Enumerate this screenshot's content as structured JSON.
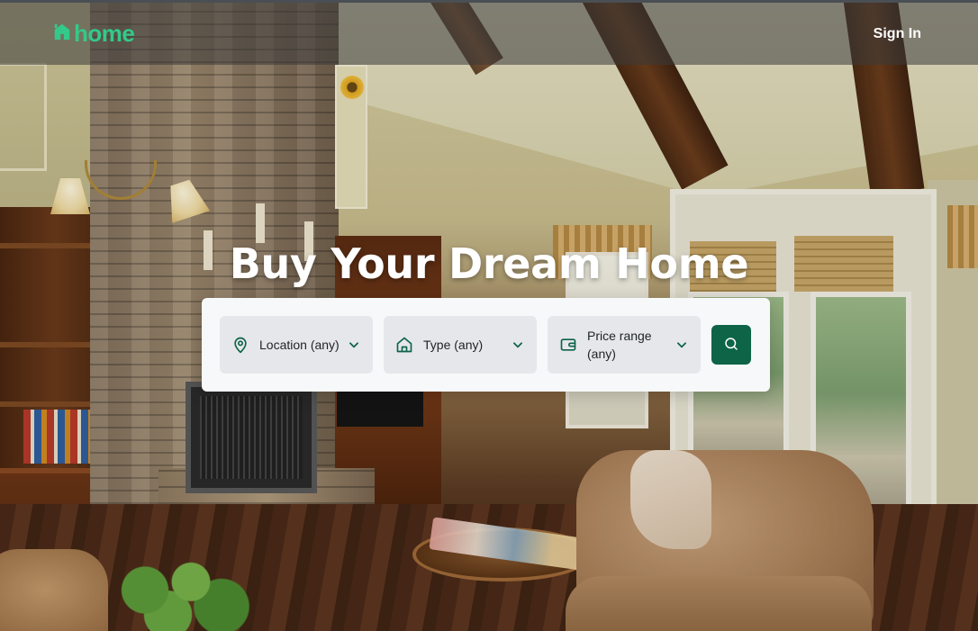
{
  "header": {
    "logo_text": "home",
    "logo_icon": "house-icon",
    "signin_label": "Sign In"
  },
  "hero": {
    "headline": "Buy Your Dream Home"
  },
  "search": {
    "filters": [
      {
        "icon": "map-pin-icon",
        "label": "Location (any)"
      },
      {
        "icon": "house-icon",
        "label": "Type (any)"
      },
      {
        "icon": "wallet-icon",
        "label": "Price range (any)"
      }
    ],
    "button_icon": "search-icon"
  },
  "colors": {
    "brand_green": "#33c98a",
    "dark_green": "#0d6447",
    "card_bg": "#f7f8f9",
    "filter_bg": "#e6e7ea"
  }
}
